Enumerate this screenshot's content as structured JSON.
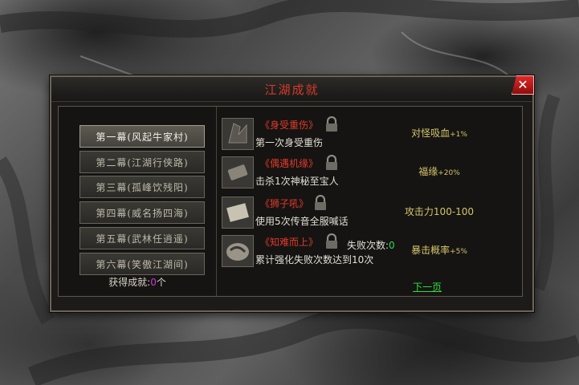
{
  "dialog": {
    "title": "江湖成就",
    "close_label": "✕"
  },
  "chapters": [
    {
      "label": "第一幕(风起牛家村)",
      "active": true
    },
    {
      "label": "第二幕(江湖行侠路)",
      "active": false
    },
    {
      "label": "第三幕(孤峰饮残阳)",
      "active": false
    },
    {
      "label": "第四幕(威名扬四海)",
      "active": false
    },
    {
      "label": "第五幕(武林任逍遥)",
      "active": false
    },
    {
      "label": "第六幕(笑傲江湖间)",
      "active": false
    }
  ],
  "summary": {
    "label": "获得成就:",
    "count": "0",
    "unit": "个"
  },
  "achievements": [
    {
      "name": "《身受重伤》",
      "desc": "第一次身受重伤",
      "reward_text": "对怪吸血",
      "reward_bonus": "+1%",
      "icon": "torn-cloth-icon"
    },
    {
      "name": "《偶遇机缘》",
      "desc": "击杀1次神秘至宝人",
      "reward_text": "福缘",
      "reward_bonus": "+20%",
      "icon": "scroll-icon"
    },
    {
      "name": "《狮子吼》",
      "desc": "使用5次传音全服喊话",
      "reward_text": "攻击力100-100",
      "reward_bonus": "",
      "icon": "paper-icon"
    },
    {
      "name": "《知难而上》",
      "desc": "累计强化失败次数达到10次",
      "reward_text": "暴击概率",
      "reward_bonus": "+5%",
      "icon": "stone-icon",
      "fail_label": "失败次数:",
      "fail_value": "0"
    }
  ],
  "pager": {
    "next_label": "下一页"
  }
}
